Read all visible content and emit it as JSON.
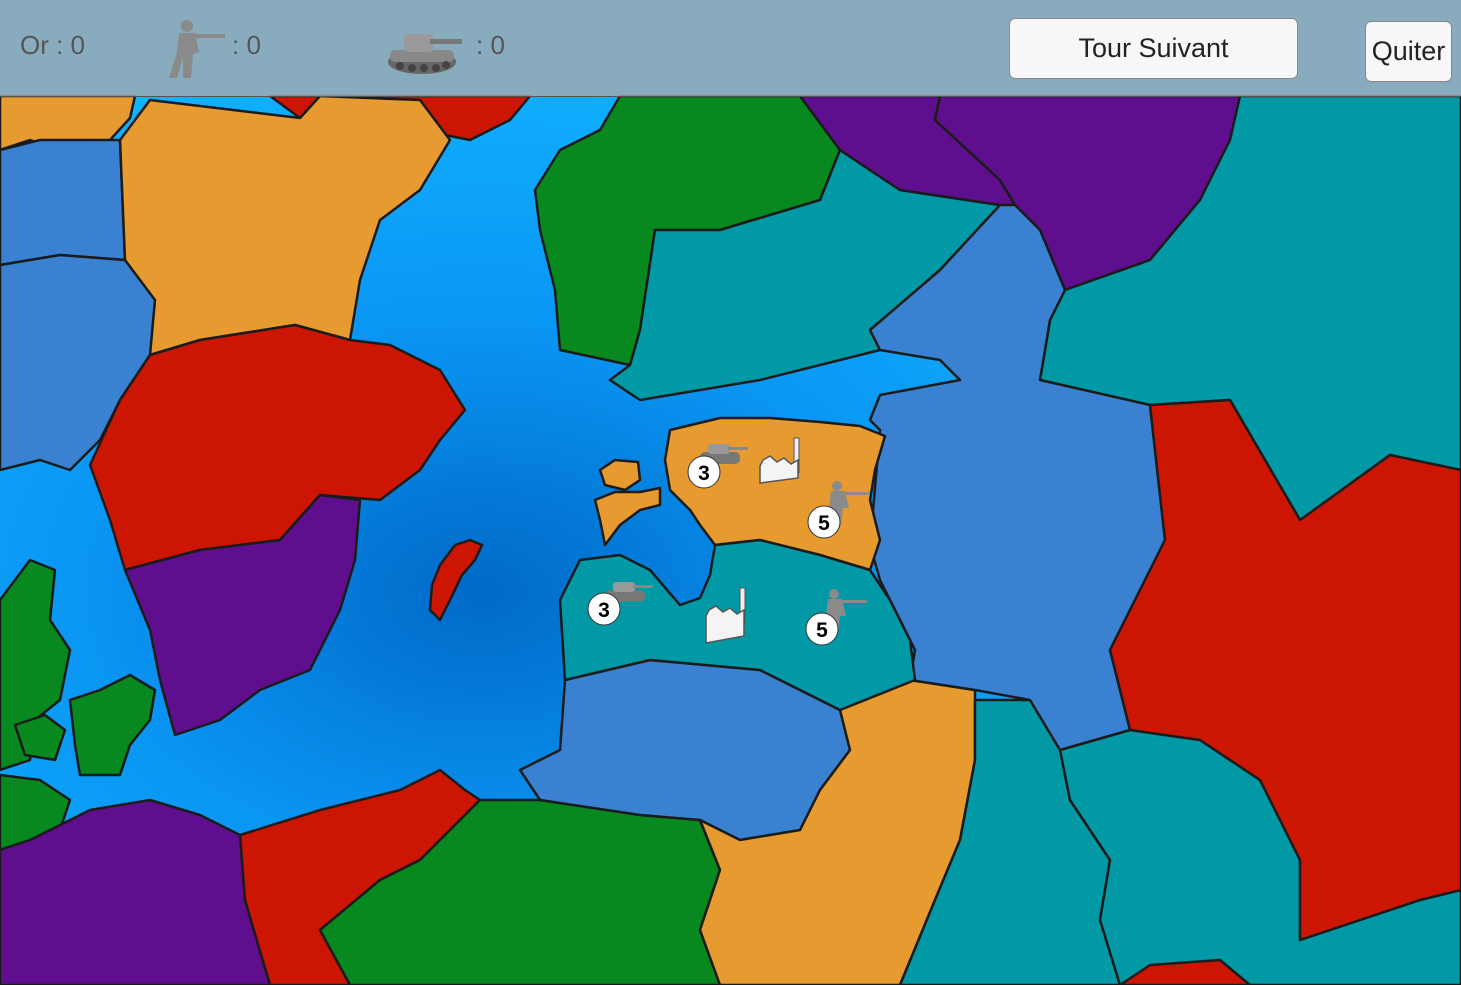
{
  "hud": {
    "gold_label": "Or : 0",
    "infantry_count": ": 0",
    "tank_count": ": 0",
    "icons": [
      "soldier-icon",
      "tank-icon"
    ]
  },
  "buttons": {
    "next_turn": "Tour Suivant",
    "quit": "Quiter"
  },
  "territories": [
    {
      "name": "orange-territory",
      "tanks": "3",
      "infantry": "5",
      "has_factory": true
    },
    {
      "name": "teal-territory",
      "tanks": "3",
      "infantry": "5",
      "has_factory": true
    }
  ],
  "colors": {
    "sea": "#0a9cf5",
    "orange": "#e79a30",
    "red": "#cc1603",
    "purple": "#5f0f8d",
    "blue": "#3a82d1",
    "teal": "#0299a6",
    "green": "#07891f"
  }
}
